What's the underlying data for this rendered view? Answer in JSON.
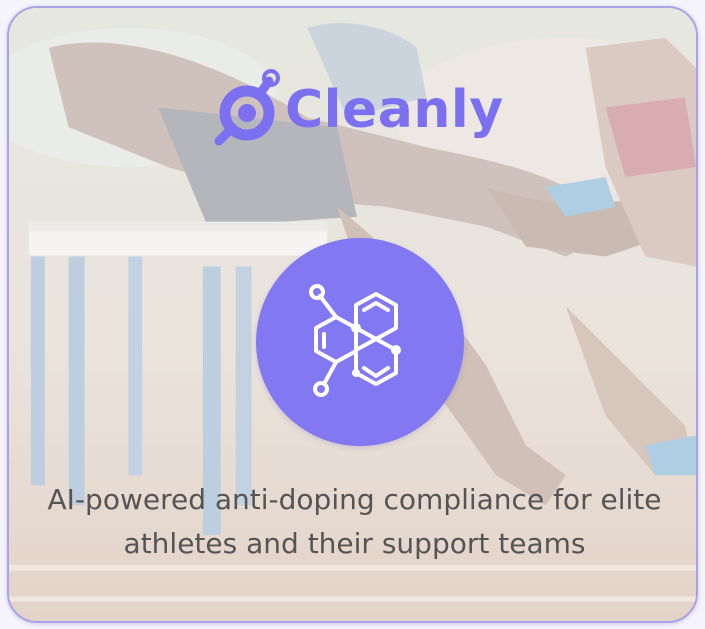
{
  "brand": {
    "name": "Cleanly",
    "accent_color": "#7a70f0",
    "logo_icon": "molecule-key-icon"
  },
  "feature": {
    "icon": "molecule-icon",
    "circle_color": "#8279f2"
  },
  "tagline": "AI-powered anti-doping compliance for elite athletes and their support teams",
  "background": {
    "image": "hurdlers-race-photo"
  }
}
